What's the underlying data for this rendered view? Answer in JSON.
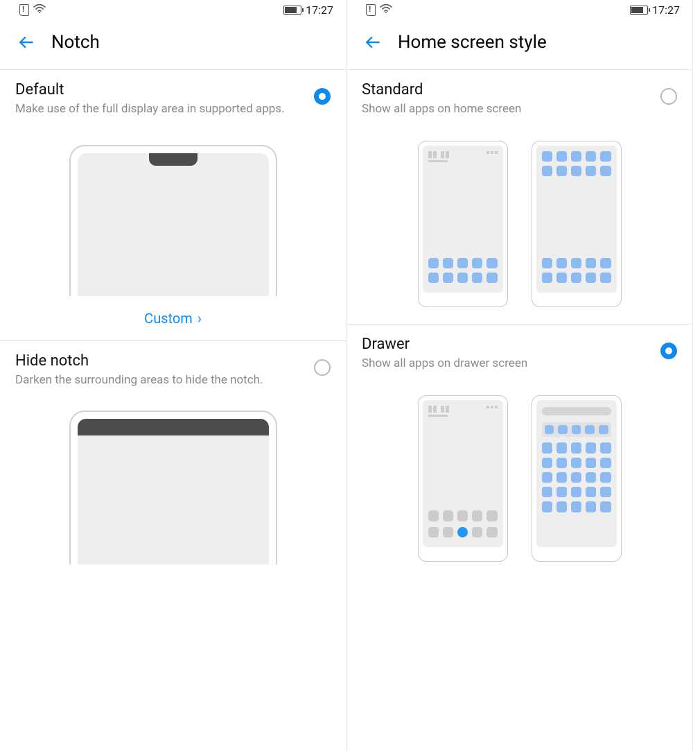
{
  "status": {
    "time": "17:27"
  },
  "left": {
    "title": "Notch",
    "options": {
      "default": {
        "title": "Default",
        "desc": "Make use of the full display area in supported apps.",
        "selected": true
      },
      "hide": {
        "title": "Hide notch",
        "desc": "Darken the surrounding areas to hide the notch.",
        "selected": false
      }
    },
    "custom_label": "Custom"
  },
  "right": {
    "title": "Home screen style",
    "options": {
      "standard": {
        "title": "Standard",
        "desc": "Show all apps on home screen",
        "selected": false
      },
      "drawer": {
        "title": "Drawer",
        "desc": "Show all apps on drawer screen",
        "selected": true
      }
    }
  }
}
